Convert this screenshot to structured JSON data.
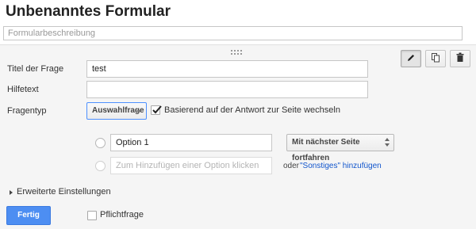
{
  "form": {
    "title": "Unbenanntes Formular",
    "description_placeholder": "Formularbeschreibung"
  },
  "question": {
    "title_label": "Titel der Frage",
    "title_value": "test",
    "help_label": "Hilfetext",
    "help_value": "",
    "type_label": "Fragentyp",
    "type_value": "Auswahlfrage",
    "branch_checked": true,
    "branch_label": "Basierend auf der Antwort zur Seite wechseln",
    "options": [
      {
        "value": "Option 1",
        "navigation": "Mit nächster Seite fortfahren"
      }
    ],
    "add_option_placeholder": "Zum Hinzufügen einer Option klicken",
    "or_text": "oder",
    "add_other_link": "\"Sonstiges\" hinzufügen",
    "advanced_label": "Erweiterte Einstellungen",
    "done_button": "Fertig",
    "required_label": "Pflichtfrage",
    "required_checked": false
  },
  "toolbar": {
    "icons": [
      "pencil-icon",
      "copy-icon",
      "trash-icon"
    ]
  },
  "colors": {
    "accent": "#4d8ef2",
    "link": "#1155cc",
    "panel": "#f5f5f5"
  }
}
